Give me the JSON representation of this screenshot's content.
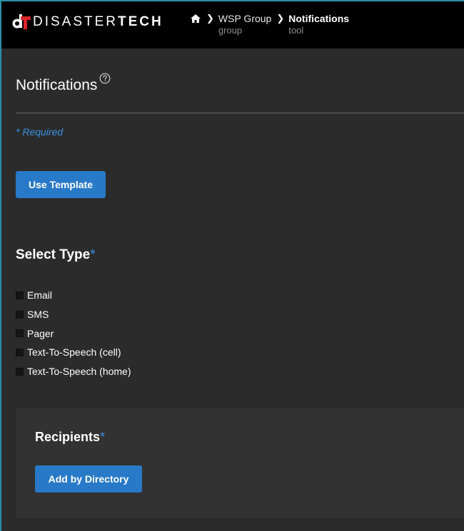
{
  "header": {
    "logo_light": "DISASTER",
    "logo_bold": "TECH",
    "breadcrumb": [
      {
        "label": "WSP Group",
        "sub": "group"
      },
      {
        "label": "Notifications",
        "sub": "tool"
      }
    ],
    "home_icon": "home-icon",
    "separator_icon": "chevron-right-icon"
  },
  "page": {
    "title": "Notifications",
    "help_icon": "help-circle-icon",
    "required_note": "* Required",
    "use_template_label": "Use Template"
  },
  "select_type": {
    "title": "Select Type",
    "asterisk": "*",
    "options": [
      {
        "label": "Email",
        "checked": false
      },
      {
        "label": "SMS",
        "checked": false
      },
      {
        "label": "Pager",
        "checked": false
      },
      {
        "label": "Text-To-Speech (cell)",
        "checked": false
      },
      {
        "label": "Text-To-Speech (home)",
        "checked": false
      }
    ]
  },
  "recipients": {
    "title": "Recipients",
    "asterisk": "*",
    "add_by_directory_label": "Add by Directory"
  },
  "colors": {
    "accent": "#2879c8",
    "required": "#3a8fe0",
    "brand_red": "#d9252b",
    "topbar": "#000000",
    "background": "#2b2b2b"
  }
}
